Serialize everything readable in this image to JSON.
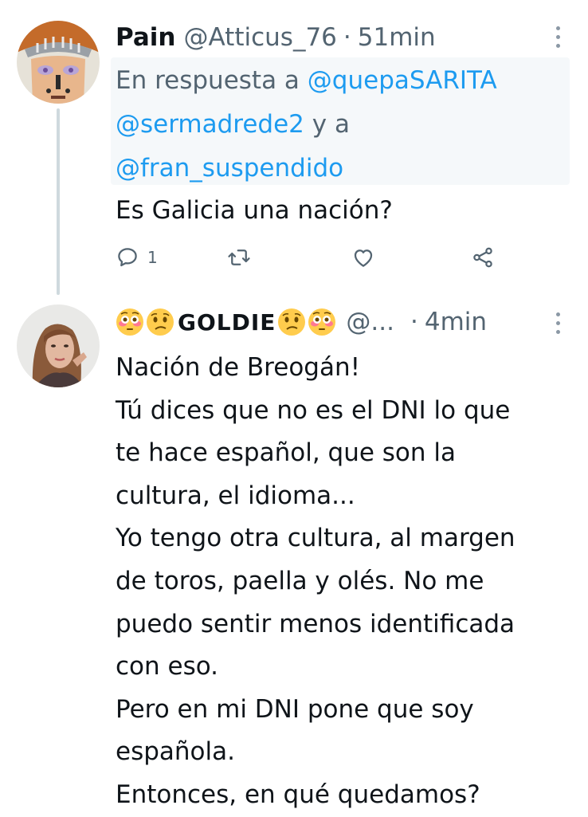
{
  "tweet1": {
    "name": "Pain",
    "handle": "@Atticus_76",
    "separator": "·",
    "time": "51min",
    "reply_prefix": "En respuesta a",
    "mention1": "@quepaSARITA",
    "mention2": "@sermadrede2",
    "reply_and": "y a",
    "mention3": "@fran_suspendido",
    "text": "Es Galicia una nación?",
    "reply_count": "1",
    "icons": [
      "reply-icon",
      "retweet-icon",
      "like-icon",
      "share-icon"
    ]
  },
  "tweet2": {
    "name_text": "GOLDIE",
    "name_emojis": [
      "flushed-face",
      "confused-face",
      "confused-face",
      "flushed-face"
    ],
    "handle": "@...",
    "separator": "·",
    "time": "4min",
    "lines": [
      "Nación de Breogán!",
      "Tú dices que no es el DNI lo que",
      "te hace español, que son la",
      "cultura, el idioma...",
      "Yo tengo otra cultura, al margen",
      "de toros, paella y olés. No me",
      "puedo sentir menos identificada",
      "con eso.",
      "Pero en mi DNI pone que soy",
      "española.",
      "Entonces, en qué quedamos?"
    ]
  },
  "colors": {
    "text": "#0f1419",
    "muted": "#536471",
    "link": "#1d9bf0",
    "thread_line": "#cfd9de"
  }
}
